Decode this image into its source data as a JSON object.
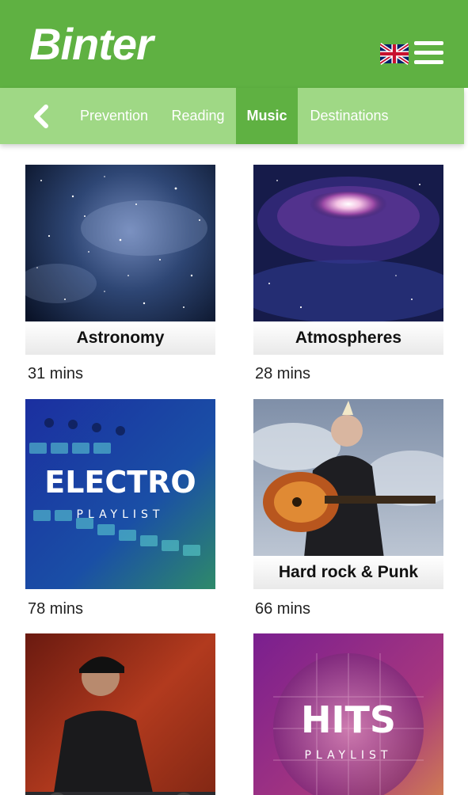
{
  "header": {
    "logo": "Binter",
    "flag_icon": "uk-flag-icon",
    "menu_icon": "hamburger-menu-icon",
    "background": "#5fb142"
  },
  "tabs": {
    "back_icon": "chevron-left-icon",
    "items": [
      {
        "label": "Prevention"
      },
      {
        "label": "Reading"
      },
      {
        "label": "Music",
        "active": true
      },
      {
        "label": "Destinations"
      }
    ],
    "background": "#9fd885",
    "active_background": "#5fb142"
  },
  "playlists": [
    {
      "title": "Astronomy",
      "duration": "31 mins"
    },
    {
      "title": "Atmospheres",
      "duration": "28 mins"
    },
    {
      "title": "",
      "cover_text": "ELECTRO",
      "cover_subtext": "PLAYLIST",
      "duration": "78 mins"
    },
    {
      "title": "Hard rock & Punk",
      "duration": "66 mins"
    },
    {
      "title": ""
    },
    {
      "title": "",
      "cover_text": "HITS",
      "cover_subtext": "PLAYLIST"
    }
  ]
}
